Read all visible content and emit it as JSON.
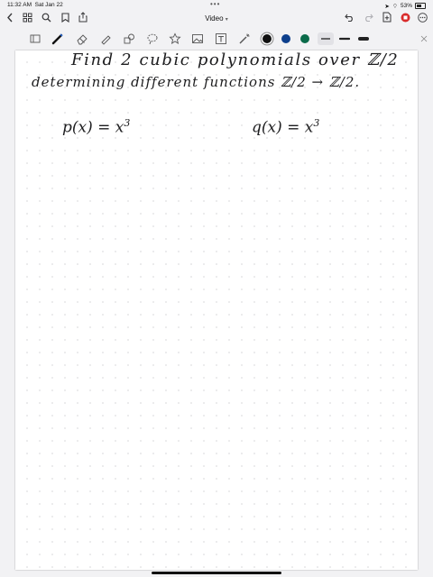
{
  "status_bar": {
    "time": "11:32 AM",
    "date": "Sat Jan 22",
    "battery": "53%",
    "icons": [
      "wifi-icon",
      "location-icon",
      "battery-icon"
    ]
  },
  "nav": {
    "title": "Video",
    "left_icons": [
      "back-chevron-icon",
      "grid-icon",
      "search-icon",
      "bookmark-icon",
      "share-icon"
    ],
    "right_icons": [
      "undo-icon",
      "redo-icon",
      "add-page-icon",
      "record-icon",
      "more-icon"
    ]
  },
  "toolbar": {
    "tools": [
      "lasso-icon",
      "pen-icon",
      "eraser-icon",
      "highlighter-icon",
      "shapes-icon",
      "lasso-select-icon",
      "sticker-icon",
      "image-icon",
      "text-icon",
      "laser-icon"
    ],
    "colors": [
      "#111111",
      "#0d3f8c",
      "#0b6b4a"
    ]
  },
  "note": {
    "line1": "Find 2 cubic polynomials over ℤ/2",
    "line2": "determining different functions ℤ/2 → ℤ/2.",
    "p_expr": "p(x) = x",
    "p_exp": "3",
    "q_expr": "q(x) = x",
    "q_exp": "3"
  }
}
